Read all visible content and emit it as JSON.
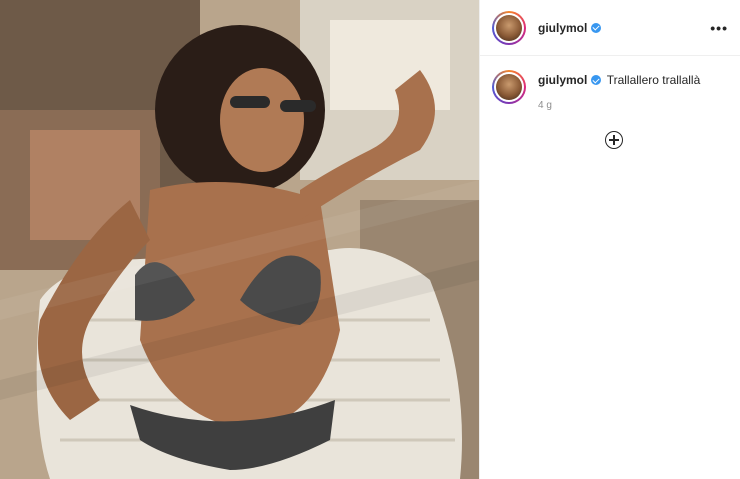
{
  "post": {
    "username": "giulymol",
    "more_icon": "more-horizontal-icon",
    "verified_icon": "verified-badge-icon"
  },
  "caption": {
    "username": "giulymol",
    "text": "Trallallero trallallà",
    "time": "4 g"
  },
  "load_more_icon": "plus-circle-icon"
}
